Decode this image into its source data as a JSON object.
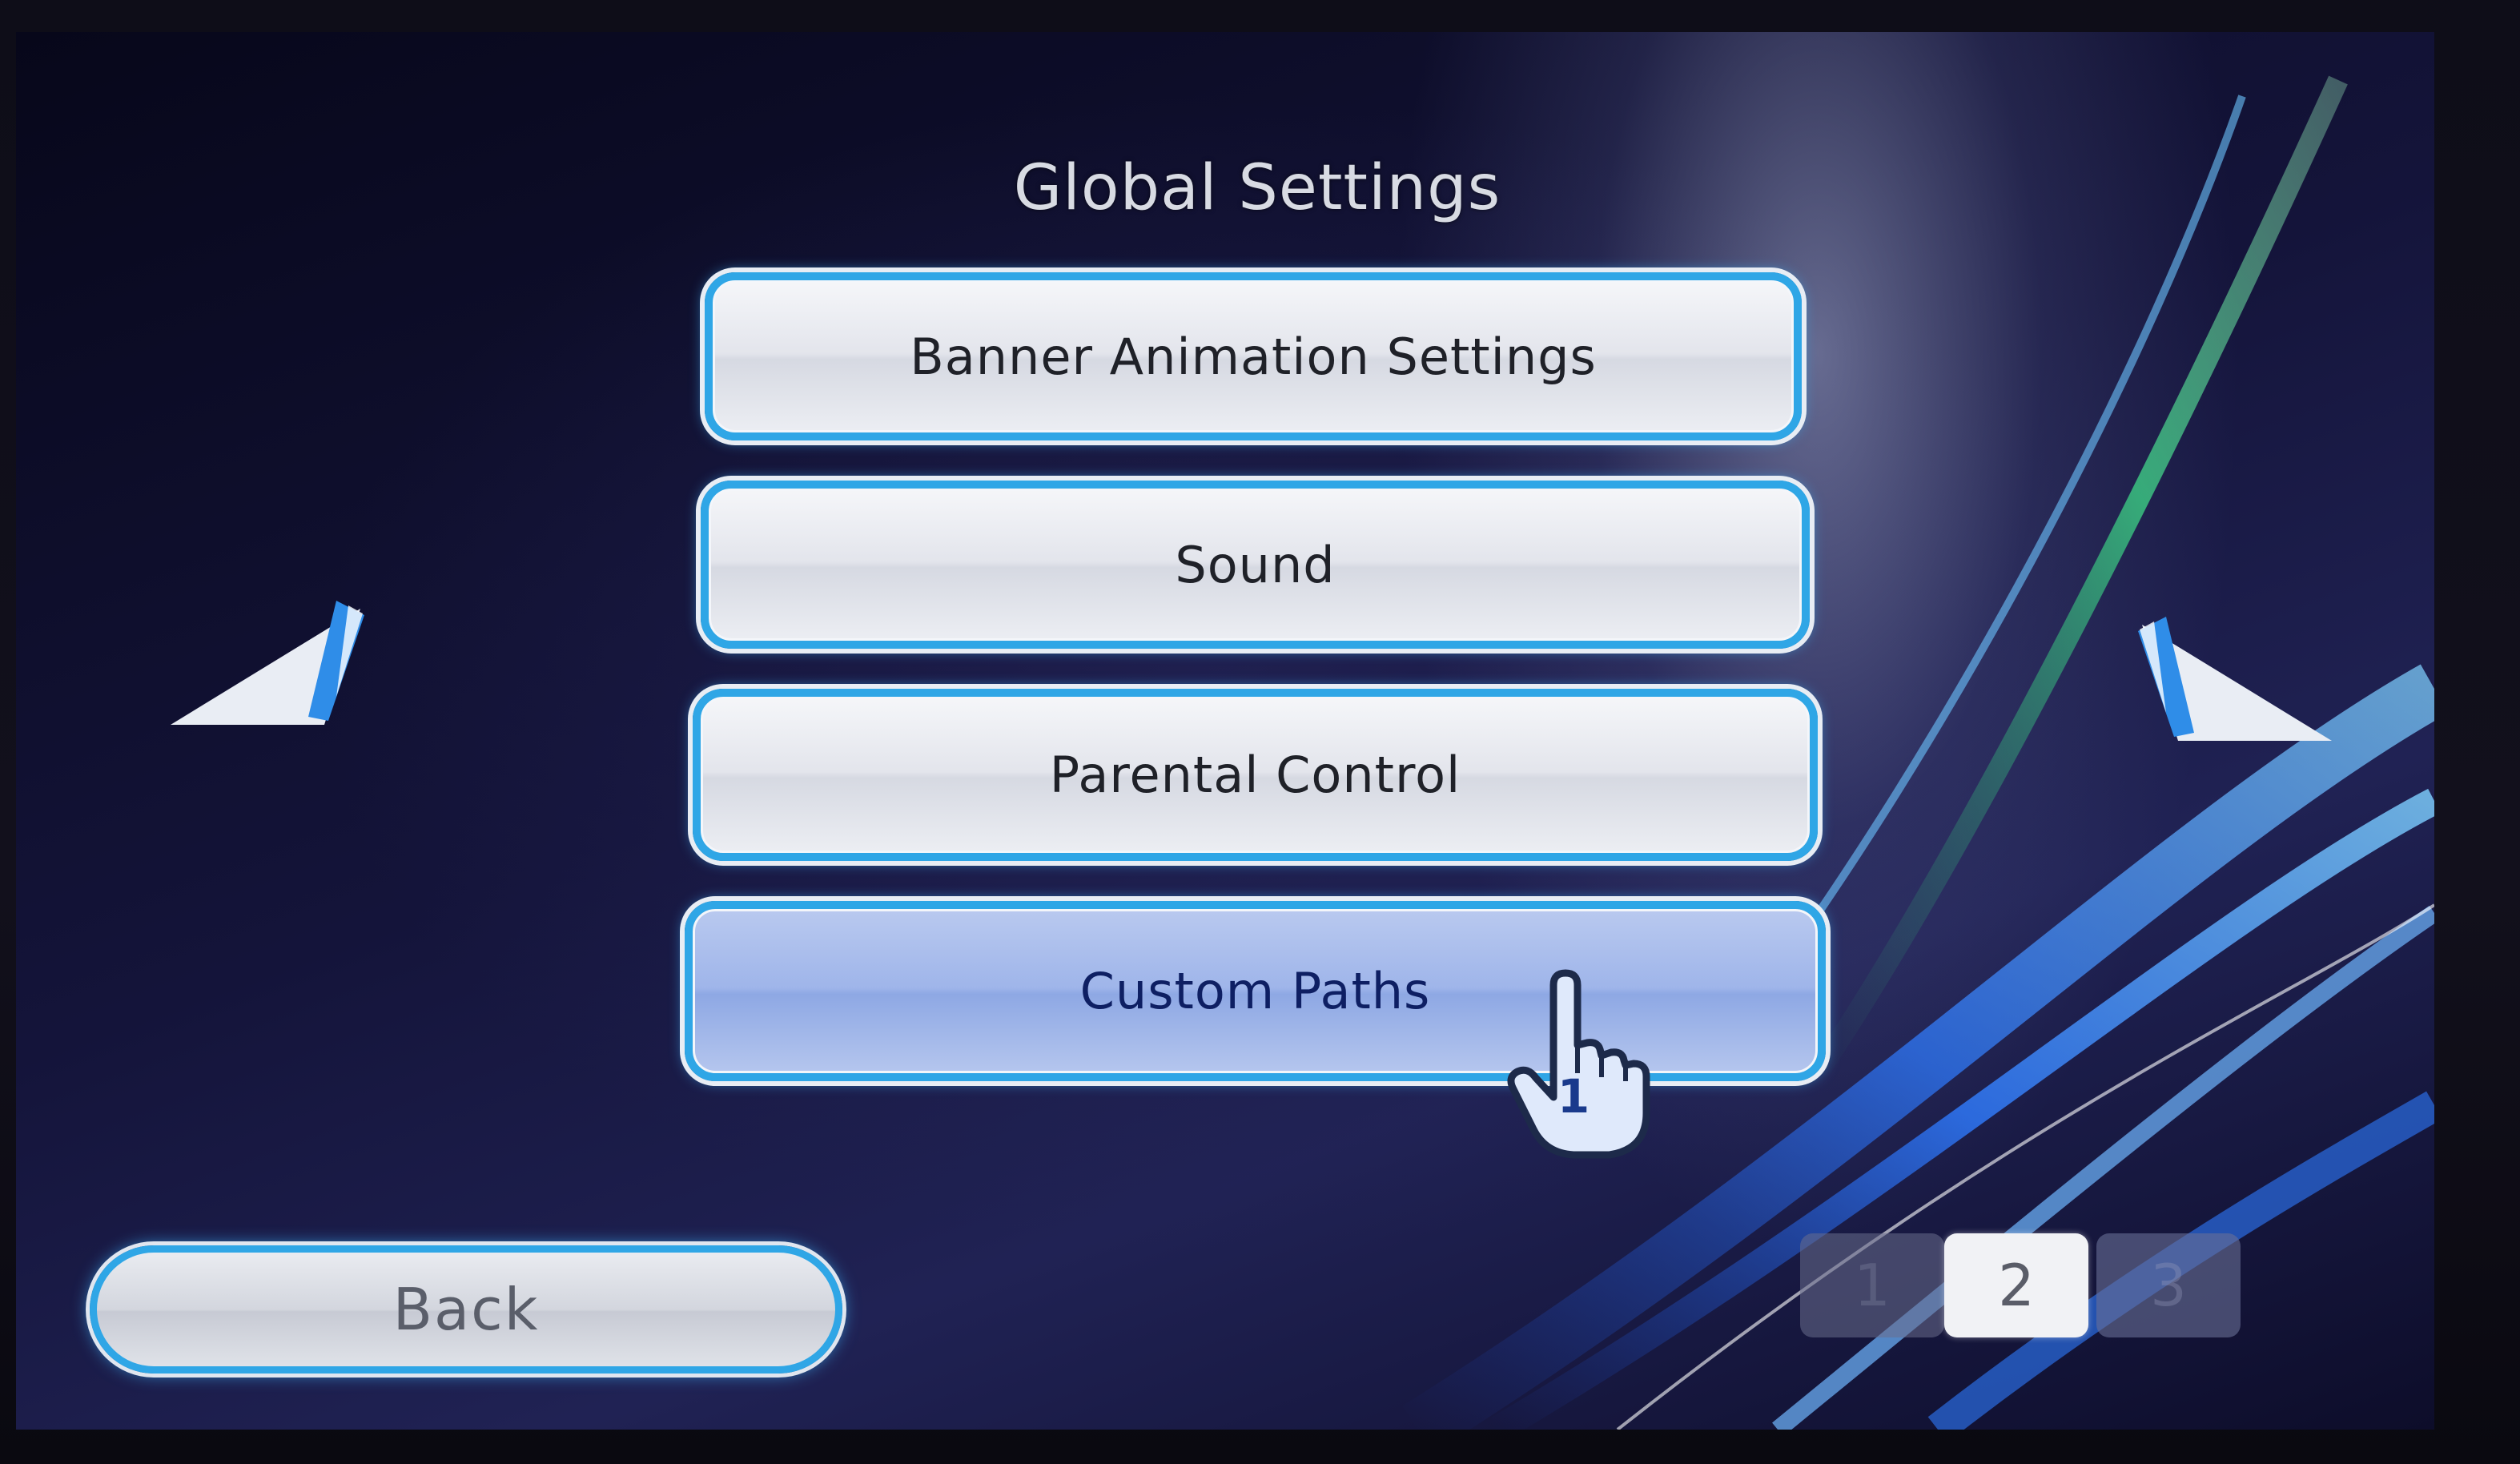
{
  "screen": {
    "title": "Global Settings"
  },
  "menu": {
    "items": [
      {
        "label": "Banner Animation Settings",
        "selected": false
      },
      {
        "label": "Sound",
        "selected": false
      },
      {
        "label": "Parental Control",
        "selected": false
      },
      {
        "label": "Custom Paths",
        "selected": true
      }
    ]
  },
  "footer": {
    "back_label": "Back"
  },
  "pager": {
    "pages": [
      "1",
      "2",
      "3"
    ],
    "current": "2"
  },
  "cursor": {
    "icon": "hand-pointer-icon",
    "player_number": "1"
  },
  "icons": {
    "previous_page": "arrow-left-icon",
    "next_page": "arrow-right-icon"
  },
  "colors": {
    "accent_border": "#2fa6e6",
    "selected_fill": "#9fb5ea",
    "button_fill": "#e3e5ec",
    "background": "#14143a"
  }
}
